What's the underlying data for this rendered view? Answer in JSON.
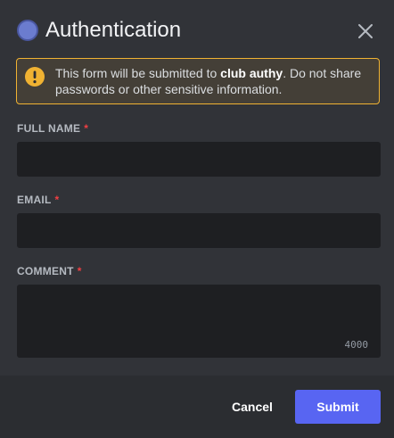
{
  "modal": {
    "title": "Authentication",
    "icon": "app-avatar-icon",
    "close_icon": "close-icon",
    "accent": "#5865f2"
  },
  "warning": {
    "icon": "warning-icon",
    "text_before": "This form will be submitted to ",
    "app_name": "club authy",
    "text_after": ". Do not share passwords or other sensitive information.",
    "color": "#f0b232"
  },
  "form": {
    "fields": [
      {
        "label": "FULL NAME",
        "required_mark": "*",
        "value": ""
      },
      {
        "label": "EMAIL",
        "required_mark": "*",
        "value": ""
      },
      {
        "label": "COMMENT",
        "required_mark": "*",
        "value": "",
        "remaining_chars": "4000"
      }
    ]
  },
  "footer": {
    "cancel_label": "Cancel",
    "submit_label": "Submit"
  }
}
